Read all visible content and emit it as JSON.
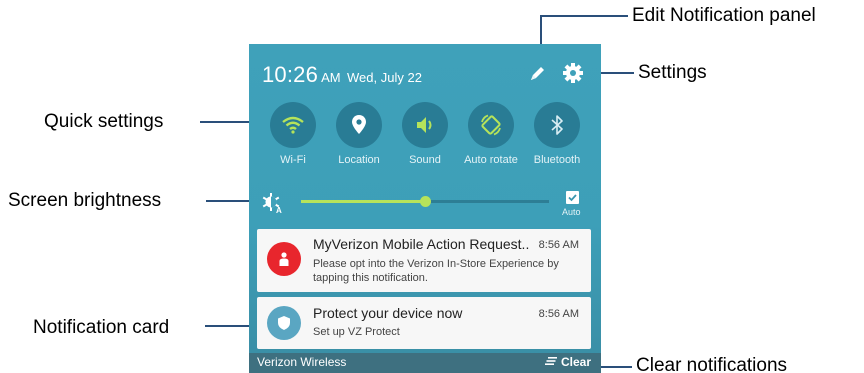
{
  "callouts": {
    "edit_panel": "Edit Notification panel",
    "settings": "Settings",
    "quick_settings": "Quick settings",
    "brightness": "Screen brightness",
    "notification_card": "Notification card",
    "clear_notifications": "Clear notifications"
  },
  "status": {
    "time": "10:26",
    "ampm": "AM",
    "date": "Wed, July 22"
  },
  "quick_settings": [
    {
      "label": "Wi-Fi",
      "icon": "wifi-icon",
      "active": true
    },
    {
      "label": "Location",
      "icon": "location-icon",
      "active": false
    },
    {
      "label": "Sound",
      "icon": "sound-icon",
      "active": true
    },
    {
      "label": "Auto rotate",
      "icon": "auto-rotate-icon",
      "active": true
    },
    {
      "label": "Bluetooth",
      "icon": "bluetooth-icon",
      "active": false
    }
  ],
  "brightness": {
    "level": 0.5,
    "auto_label": "Auto",
    "auto_checked": true
  },
  "notifications": [
    {
      "title": "MyVerizon Mobile Action Request..",
      "time": "8:56 AM",
      "body": "Please opt into the Verizon In-Store Experience by tapping this notification.",
      "icon": "person-icon",
      "color": "#e8262d"
    },
    {
      "title": "Protect your device now",
      "time": "8:56 AM",
      "body": "Set up VZ Protect",
      "icon": "shield-icon",
      "color": "#5aa6c2"
    }
  ],
  "bottom_bar": {
    "carrier": "Verizon Wireless",
    "clear_label": "Clear"
  },
  "colors": {
    "panel_bg": "#3fa1ba",
    "qs_circle": "#297c95",
    "active_accent": "#b6e35a",
    "callout_line": "#2a4f7a"
  }
}
